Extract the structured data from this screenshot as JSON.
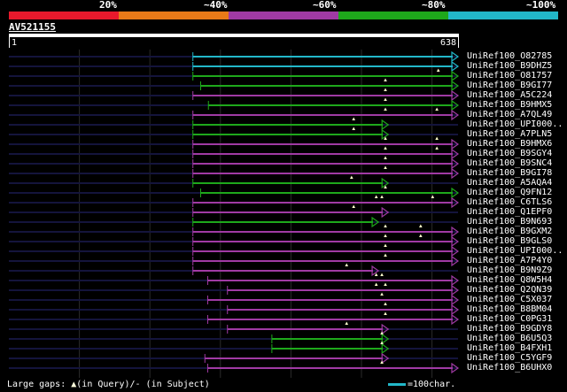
{
  "legend": {
    "labels": [
      "20%",
      "~40%",
      "~60%",
      "~80%",
      "~100%"
    ],
    "colors": [
      "#e8192c",
      "#e97a18",
      "#a03aa4",
      "#1ea81b",
      "#22b7c9"
    ]
  },
  "query": {
    "id": "AV521155",
    "start_label": "1",
    "end_label": "638",
    "length": 638
  },
  "hits": [
    {
      "label": "UniRef100_O82785",
      "start": 262,
      "end": 638,
      "color": "#22b7c9",
      "gaps": []
    },
    {
      "label": "UniRef100_B9DHZ5",
      "start": 262,
      "end": 638,
      "color": "#22b7c9",
      "gaps": []
    },
    {
      "label": "UniRef100_O81757",
      "start": 262,
      "end": 638,
      "color": "#1ea81b",
      "gaps": [
        610
      ]
    },
    {
      "label": "UniRef100_B9GI77",
      "start": 273,
      "end": 638,
      "color": "#1ea81b",
      "gaps": [
        535
      ]
    },
    {
      "label": "UniRef100_A5C224",
      "start": 262,
      "end": 638,
      "color": "#a03aa4",
      "gaps": [
        535
      ]
    },
    {
      "label": "UniRef100_B9HMX5",
      "start": 284,
      "end": 638,
      "color": "#1ea81b",
      "gaps": [
        535
      ]
    },
    {
      "label": "UniRef100_A7QL49",
      "start": 262,
      "end": 638,
      "color": "#a03aa4",
      "gaps": [
        535,
        608
      ]
    },
    {
      "label": "UniRef100_UPI000..",
      "start": 262,
      "end": 539,
      "color": "#1ea81b",
      "gaps": [
        490
      ]
    },
    {
      "label": "UniRef100_A7PLN5",
      "start": 262,
      "end": 539,
      "color": "#1ea81b",
      "gaps": [
        490
      ]
    },
    {
      "label": "UniRef100_B9HMX6",
      "start": 262,
      "end": 638,
      "color": "#a03aa4",
      "gaps": [
        535,
        608
      ]
    },
    {
      "label": "UniRef100_B9SGY4",
      "start": 262,
      "end": 638,
      "color": "#a03aa4",
      "gaps": [
        535,
        608
      ]
    },
    {
      "label": "UniRef100_B9SNC4",
      "start": 262,
      "end": 638,
      "color": "#a03aa4",
      "gaps": [
        535
      ]
    },
    {
      "label": "UniRef100_B9GI78",
      "start": 262,
      "end": 638,
      "color": "#a03aa4",
      "gaps": [
        535
      ]
    },
    {
      "label": "UniRef100_A5AQA4",
      "start": 262,
      "end": 539,
      "color": "#1ea81b",
      "gaps": [
        487
      ]
    },
    {
      "label": "UniRef100_Q9FN12",
      "start": 273,
      "end": 638,
      "color": "#1ea81b",
      "gaps": [
        535
      ]
    },
    {
      "label": "UniRef100_C6TLS6",
      "start": 262,
      "end": 638,
      "color": "#a03aa4",
      "gaps": [
        522,
        530,
        602
      ]
    },
    {
      "label": "UniRef100_Q1EPF0",
      "start": 262,
      "end": 539,
      "color": "#a03aa4",
      "gaps": [
        490
      ]
    },
    {
      "label": "UniRef100_B9N693",
      "start": 262,
      "end": 525,
      "color": "#1ea81b",
      "gaps": []
    },
    {
      "label": "UniRef100_B9GXM2",
      "start": 262,
      "end": 638,
      "color": "#a03aa4",
      "gaps": [
        535,
        585
      ]
    },
    {
      "label": "UniRef100_B9GLS0",
      "start": 262,
      "end": 638,
      "color": "#a03aa4",
      "gaps": [
        535,
        585
      ]
    },
    {
      "label": "UniRef100_UPI000..",
      "start": 262,
      "end": 638,
      "color": "#a03aa4",
      "gaps": [
        535
      ]
    },
    {
      "label": "UniRef100_A7P4Y0",
      "start": 262,
      "end": 638,
      "color": "#a03aa4",
      "gaps": [
        535
      ]
    },
    {
      "label": "UniRef100_B9N9Z9",
      "start": 262,
      "end": 525,
      "color": "#a03aa4",
      "gaps": [
        480
      ]
    },
    {
      "label": "UniRef100_Q8W5H4",
      "start": 283,
      "end": 638,
      "color": "#a03aa4",
      "gaps": [
        522,
        530
      ]
    },
    {
      "label": "UniRef100_Q2QN39",
      "start": 311,
      "end": 638,
      "color": "#a03aa4",
      "gaps": [
        522,
        535
      ]
    },
    {
      "label": "UniRef100_C5X037",
      "start": 283,
      "end": 638,
      "color": "#a03aa4",
      "gaps": [
        530
      ]
    },
    {
      "label": "UniRef100_B8BM04",
      "start": 311,
      "end": 638,
      "color": "#a03aa4",
      "gaps": [
        535
      ]
    },
    {
      "label": "UniRef100_C0PG31",
      "start": 283,
      "end": 638,
      "color": "#a03aa4",
      "gaps": [
        535
      ]
    },
    {
      "label": "UniRef100_B9GDY8",
      "start": 311,
      "end": 539,
      "color": "#a03aa4",
      "gaps": [
        480
      ]
    },
    {
      "label": "UniRef100_B6U5Q3",
      "start": 374,
      "end": 539,
      "color": "#1ea81b",
      "gaps": [
        530
      ]
    },
    {
      "label": "UniRef100_B4FXH1",
      "start": 374,
      "end": 539,
      "color": "#1ea81b",
      "gaps": [
        530
      ]
    },
    {
      "label": "UniRef100_C5YGF9",
      "start": 279,
      "end": 539,
      "color": "#a03aa4",
      "gaps": []
    },
    {
      "label": "UniRef100_B6UHX0",
      "start": 283,
      "end": 638,
      "color": "#a03aa4",
      "gaps": [
        530
      ]
    }
  ],
  "footer": {
    "gaps_prefix": "Large gaps: ",
    "gaps_query": "(in Query)/- (in Subject)",
    "scale_text": "=100char."
  }
}
